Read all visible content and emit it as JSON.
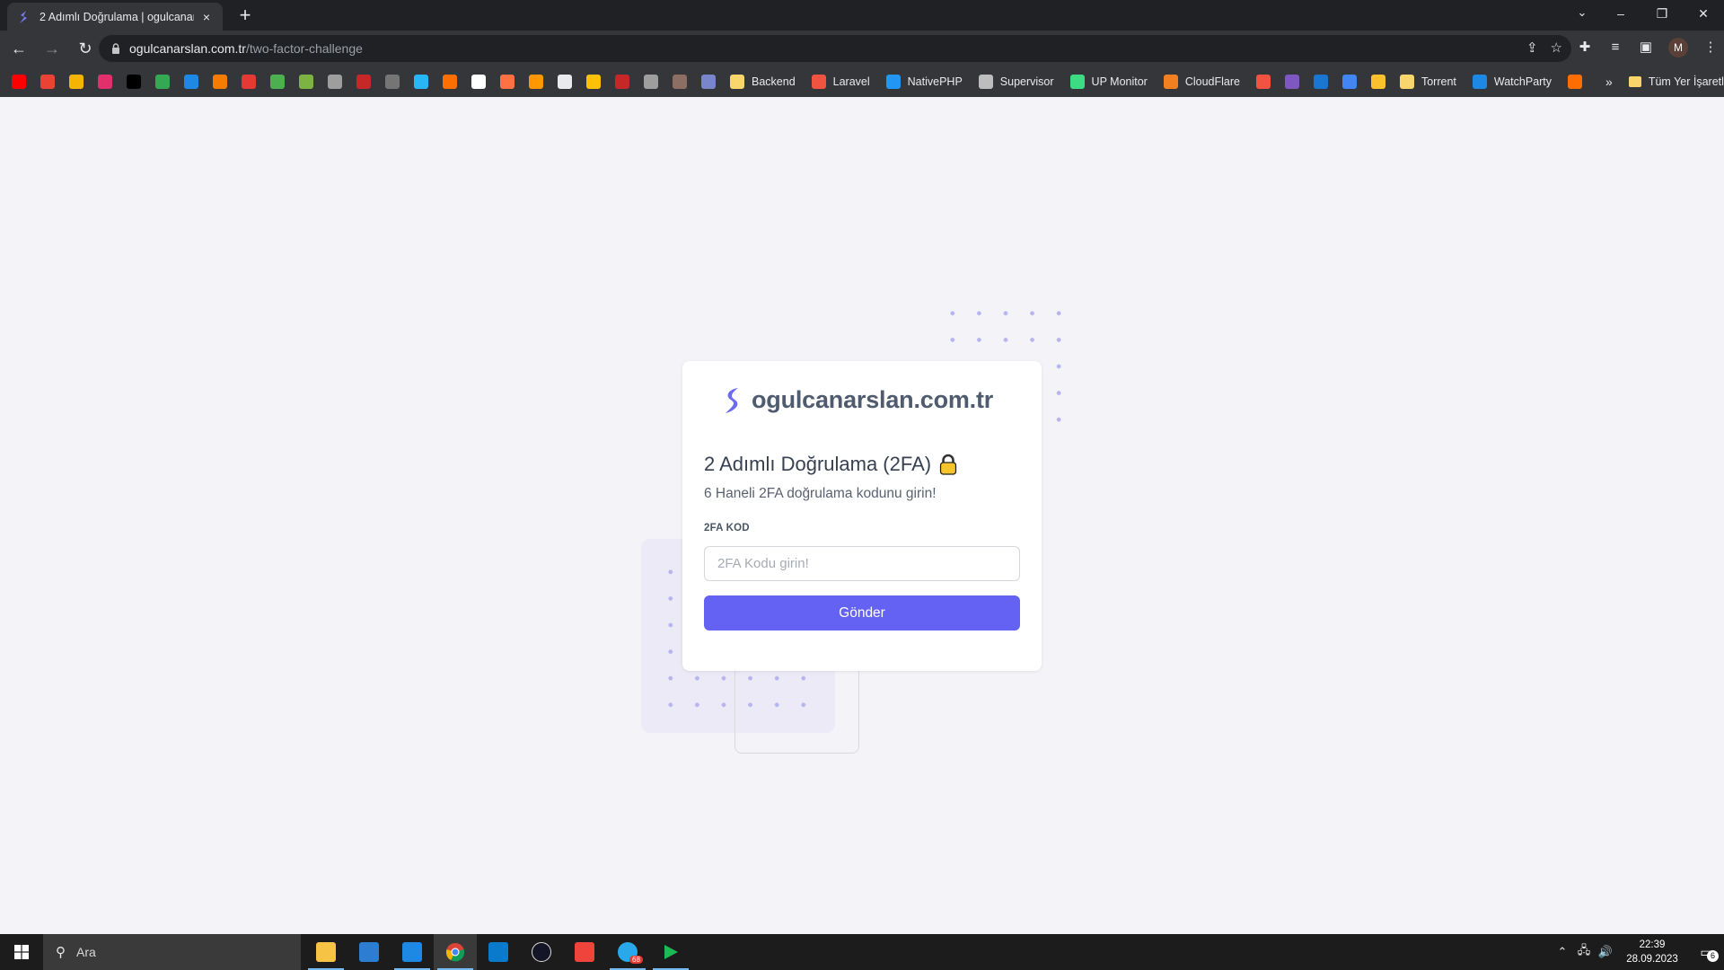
{
  "browser": {
    "tab": {
      "title": "2 Adımlı Doğrulama | ogulcanarslan.com.tr",
      "close": "×"
    },
    "new_tab": "+",
    "window_controls": [
      "⌄",
      "–",
      "❐",
      "✕"
    ],
    "url": {
      "host": "ogulcanarslan.com.tr",
      "path": "/two-factor-challenge"
    },
    "avatar_letter": "M"
  },
  "bookmarks": {
    "icon_colors": [
      "#ff0000",
      "#ea4335",
      "#f4b400",
      "#e1306c",
      "#000000",
      "#34a853",
      "#1e88e5",
      "#f57c00",
      "#e53935",
      "#4caf50",
      "#7cb342",
      "#9e9e9e",
      "#c62828",
      "#757575",
      "#29b6f6",
      "#ff6f00",
      "#ffffff",
      "#ff7043",
      "#ff9800",
      "#e8eaed",
      "#ffc107",
      "#c62828",
      "#9e9e9e",
      "#8d6e63",
      "#7986cb"
    ],
    "items": [
      {
        "label": "Backend",
        "color": "#f9d66b"
      },
      {
        "label": "Laravel",
        "color": "#f05340"
      },
      {
        "label": "NativePHP",
        "color": "#2196f3"
      },
      {
        "label": "Supervisor",
        "color": "#bdbdbd"
      },
      {
        "label": "UP Monitor",
        "color": "#3ddc84"
      },
      {
        "label": "CloudFlare",
        "color": "#f38020"
      }
    ],
    "icon_colors_2": [
      "#f05340",
      "#7e57c2",
      "#1976d2",
      "#4285f4",
      "#fbc02d"
    ],
    "items_2": [
      {
        "label": "Torrent",
        "color": "#f9d66b"
      },
      {
        "label": "WatchParty",
        "color": "#1e88e5"
      }
    ],
    "more": "»",
    "all_bookmarks": "Tüm Yer İşaretleri"
  },
  "card": {
    "brand": "ogulcanarslan.com.tr",
    "title": "2 Adımlı Doğrulama (2FA)",
    "subtitle": "6 Haneli 2FA doğrulama kodunu girin!",
    "field_label": "2FA KOD",
    "input_placeholder": "2FA Kodu girin!",
    "input_value": "",
    "submit_label": "Gönder",
    "accent": "#6462f3"
  },
  "taskbar": {
    "search_placeholder": "Ara",
    "time": "22:39",
    "date": "28.09.2023",
    "notification_count": "6",
    "telegram_badge": "68"
  }
}
